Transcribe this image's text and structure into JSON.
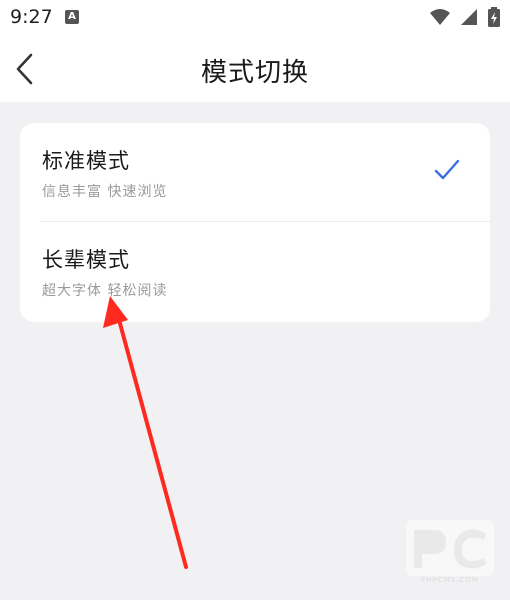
{
  "status": {
    "time": "9:27",
    "notification_glyph": "A"
  },
  "appbar": {
    "title": "模式切换"
  },
  "modes": [
    {
      "title": "标准模式",
      "subtitle": "信息丰富 快速浏览",
      "selected": true
    },
    {
      "title": "长辈模式",
      "subtitle": "超大字体 轻松阅读",
      "selected": false
    }
  ],
  "watermark": {
    "text": "PHPCMS.COM"
  },
  "colors": {
    "accent": "#3b6fe0",
    "arrow": "#ff2a1f",
    "background": "#f1f1f3"
  }
}
